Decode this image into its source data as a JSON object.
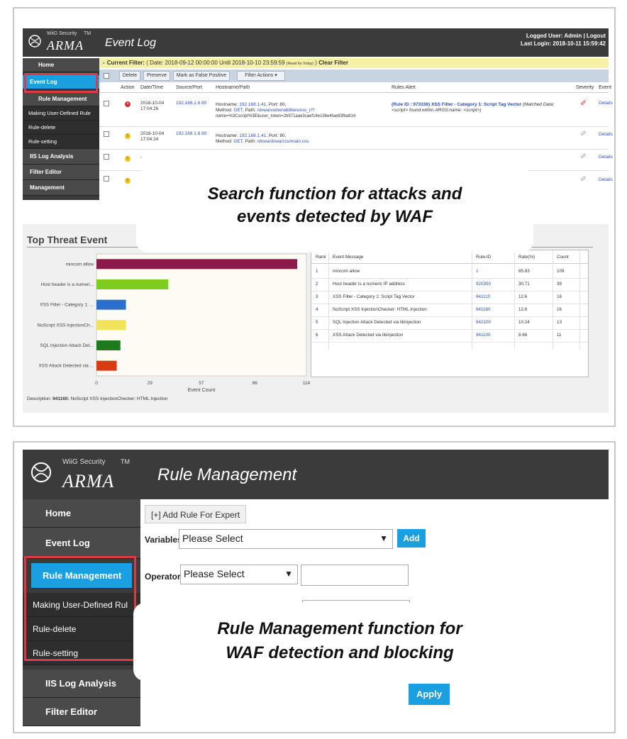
{
  "panel1": {
    "brand": {
      "company": "WiiG Security",
      "tm": "TM",
      "product": "ARMA"
    },
    "title": "Event Log",
    "logged_user": "Logged User: Admin | Logout",
    "last_login": "Last Login: 2018-10-11 15:59:42",
    "sidebar": [
      "Home",
      "Event Log",
      "Rule Management",
      "Making User-Defined Rule",
      "Rule-delete",
      "Rule-setting",
      "IIS Log Analysis",
      "Filter Editor",
      "Management"
    ],
    "filter_label": "Current Filter:",
    "filter_text": "( Date: 2018-09-12 00:00:00 Until 2018-10-10 23:59:59",
    "reset_label": "(Reset for Today)",
    "filter_close": ")",
    "clear_filter": "Clear Filter",
    "toolbar": {
      "delete": "Delete",
      "preserve": "Preserve",
      "false_positive": "Mark as False Positive",
      "filter_actions": "Filter Actions"
    },
    "columns": [
      "Action",
      "Date/Time",
      "Source/Port",
      "Hostname/Path",
      "Rules Alert",
      "Severity",
      "Event"
    ],
    "rows": [
      {
        "date": "2018-10-04",
        "time": "17:04:26",
        "src": "192.168.1.6 80",
        "host_label": "Hostname:",
        "host": "192.168.1.41",
        "port": ", Port: 80,",
        "method_label": "Method:",
        "method": "GET",
        "path_label": ", Path:",
        "path": "/dvwa/vulnerabilities/xss_r/?",
        "extra": "name=%3Cscript%3E&user_token=2b971aae3caef14e156e4fae83fba814",
        "alert_id": "(Rule ID : 973336) XSS Filter - Category 1: Script Tag Vector",
        "alert_extra": "(Matched Data: <script> found within ARGS:name: <script>)",
        "details": "Details"
      },
      {
        "date": "2018-10-04",
        "time": "17:04:24",
        "src": "192.168.1.6 80",
        "host_label": "Hostname:",
        "host": "192.168.1.41",
        "port": ", Port: 80,",
        "method_label": "Method:",
        "method": "GET",
        "path_label": ", Path:",
        "path": "/dvwa/dvwa/css/main.css",
        "details": "Details"
      },
      {
        "date": "-",
        "details": "Details"
      },
      {
        "details": "Details"
      }
    ],
    "callout": [
      "Search function for attacks and",
      "events detected by WAF"
    ],
    "threat_title": "Top Threat Event",
    "description_label": "Description:",
    "description_id": "941160:",
    "description_text": "NoScript XSS InjectionChecker: HTML Injection",
    "rank_table": {
      "headers": [
        "Rank",
        "Event Message",
        "Rule-ID",
        "Rate(%)",
        "Count"
      ],
      "rows": [
        [
          "1",
          "mincom allow",
          "1",
          "85.83",
          "109"
        ],
        [
          "2",
          "Host header is a numeric IP address",
          "920350",
          "30.71",
          "39"
        ],
        [
          "3",
          "XSS Filter - Category 1: Script Tag Vector",
          "941110",
          "12.6",
          "16"
        ],
        [
          "4",
          "NoScript XSS InjectionChecker: HTML Injection",
          "941160",
          "12.6",
          "16"
        ],
        [
          "5",
          "SQL Injection Attack Detected via libinjection",
          "942100",
          "10.24",
          "13"
        ],
        [
          "6",
          "XSS Attack Detected via libinjection",
          "941100",
          "8.66",
          "11"
        ]
      ]
    }
  },
  "chart_data": {
    "type": "bar",
    "orientation": "horizontal",
    "categories": [
      "mincom allow",
      "Host header is a numeri...",
      "XSS Filter - Category 1: ...",
      "NoScript XSS InjectionCh...",
      "SQL Injection Attack Det...",
      "XSS Attack Detected via ..."
    ],
    "values": [
      109,
      39,
      16,
      16,
      13,
      11
    ],
    "colors": [
      "#8b1a4a",
      "#7ccd1f",
      "#2a6fd0",
      "#f2e35a",
      "#1f7a1f",
      "#d93a10"
    ],
    "xticks": [
      "0",
      "29",
      "57",
      "86",
      "114"
    ],
    "xlim": [
      0,
      114
    ],
    "xlabel": "Event Count",
    "grid": false
  },
  "panel2": {
    "brand": {
      "company": "WiiG Security",
      "tm": "TM",
      "product": "ARMA"
    },
    "title": "Rule Management",
    "sidebar": [
      "Home",
      "Event Log",
      "Rule Management",
      "Making User-Defined Rul",
      "Rule-delete",
      "Rule-setting",
      "IIS Log Analysis",
      "Filter Editor"
    ],
    "add_rule": "[+] Add Rule For Expert",
    "variables_label": "Variables",
    "variables_value": "Please Select",
    "add_button": "Add",
    "operator_label": "Operator",
    "operator_value": "Please Select",
    "apply_button": "Apply",
    "callout": [
      "Rule Management function for",
      "WAF detection and blocking"
    ]
  },
  "colors": {
    "accent": "#1a9fe0",
    "highlight": "#e2383f",
    "appbar": "#3b3b3b"
  }
}
